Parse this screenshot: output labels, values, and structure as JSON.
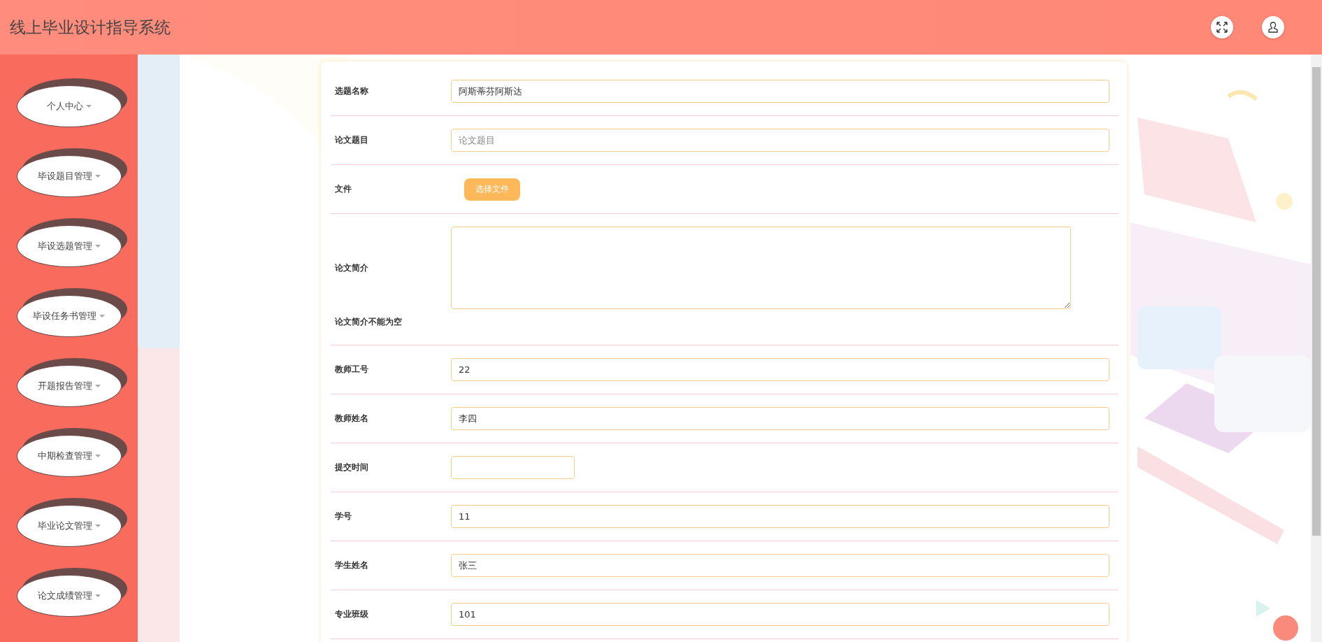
{
  "header": {
    "title": "线上毕业设计指导系统"
  },
  "sidebar": {
    "items": [
      {
        "label": "个人中心"
      },
      {
        "label": "毕设题目管理"
      },
      {
        "label": "毕设选题管理"
      },
      {
        "label": "毕设任务书管理"
      },
      {
        "label": "开题报告管理"
      },
      {
        "label": "中期检查管理"
      },
      {
        "label": "毕业论文管理"
      },
      {
        "label": "论文成绩管理"
      }
    ]
  },
  "form": {
    "fields": [
      {
        "kind": "input",
        "label": "选题名称",
        "value": "阿斯蒂芬阿斯达"
      },
      {
        "kind": "input",
        "label": "论文题目",
        "placeholder": "论文题目"
      },
      {
        "kind": "file",
        "label": "文件",
        "button": "选择文件"
      },
      {
        "kind": "textarea",
        "label": "论文简介",
        "error": "论文简介不能为空"
      },
      {
        "kind": "input",
        "label": "教师工号",
        "value": "22"
      },
      {
        "kind": "input",
        "label": "教师姓名",
        "value": "李四"
      },
      {
        "kind": "date",
        "label": "提交时间"
      },
      {
        "kind": "input",
        "label": "学号",
        "value": "11"
      },
      {
        "kind": "input",
        "label": "学生姓名",
        "value": "张三"
      },
      {
        "kind": "input",
        "label": "专业班级",
        "value": "101"
      }
    ]
  }
}
